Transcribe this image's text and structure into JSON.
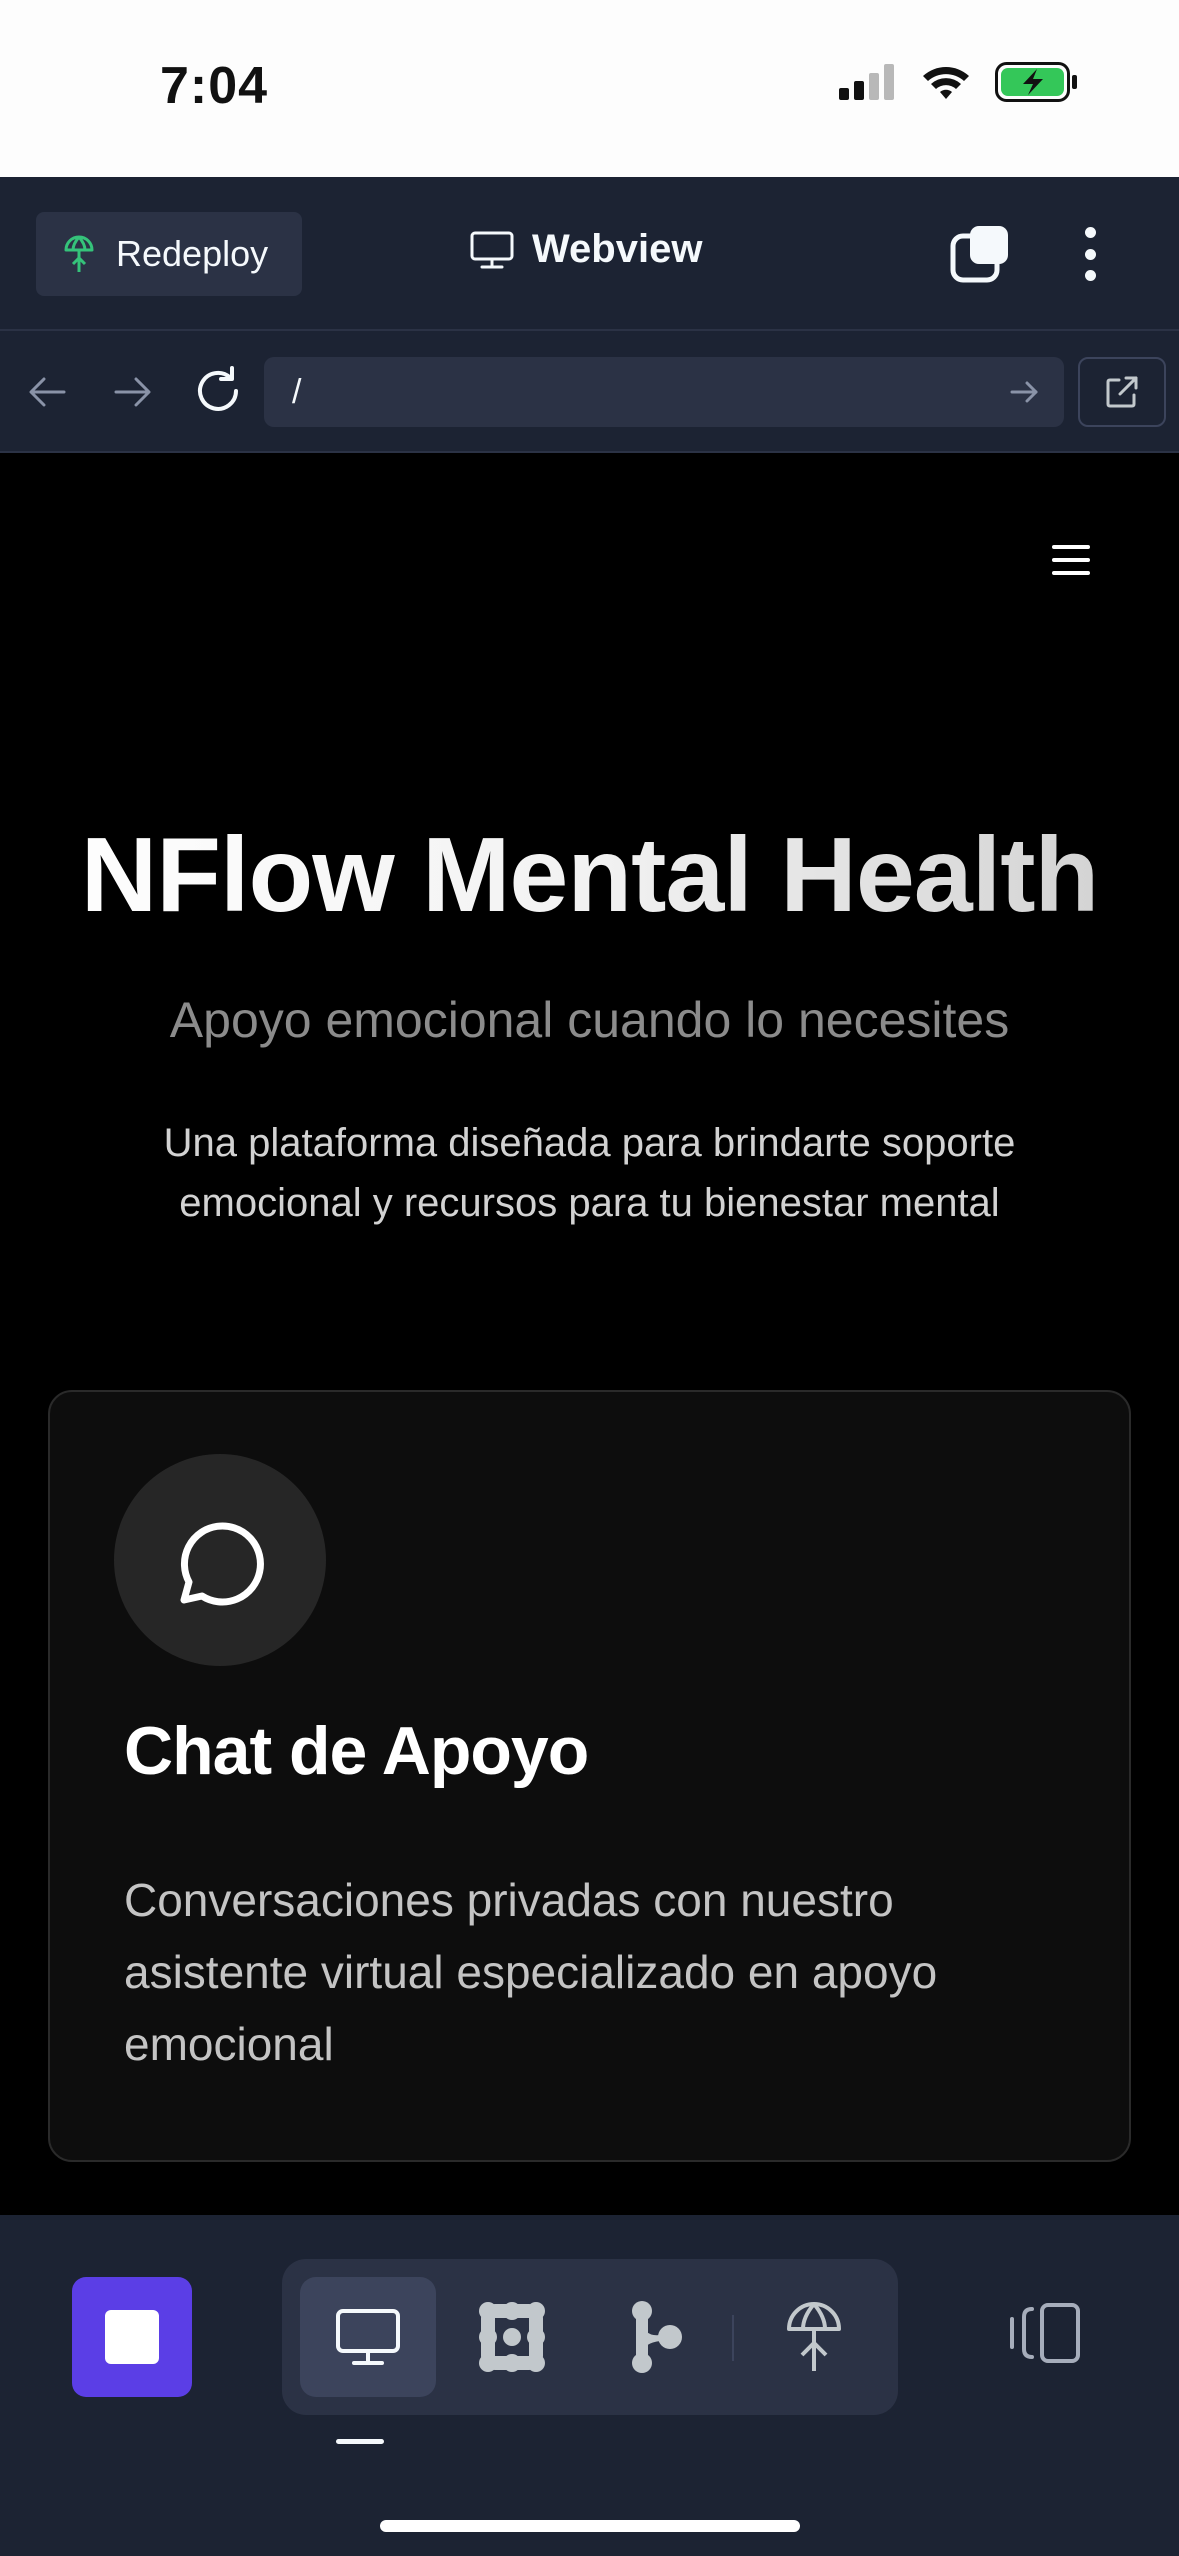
{
  "status_bar": {
    "time": "7:04",
    "icons": [
      "cellular-signal-icon",
      "wifi-icon",
      "battery-charging-icon"
    ]
  },
  "top_bar": {
    "redeploy_label": "Redeploy",
    "webview_label": "Webview",
    "icons": [
      "deploy-icon",
      "monitor-icon",
      "tabs-icon",
      "more-options-icon"
    ]
  },
  "url_bar": {
    "url": "/"
  },
  "page": {
    "title": "NFlow Mental Health",
    "subtitle": "Apoyo emocional cuando lo necesites",
    "description": "Una plataforma diseñada para brindarte soporte emocional y recursos para tu bienestar mental",
    "feature_card": {
      "icon": "chat-bubble-icon",
      "title": "Chat de Apoyo",
      "description": "Conversaciones privadas con nuestro asistente virtual especializado en apoyo emocional"
    }
  },
  "bottom_toolbar": {
    "tools": [
      "webview-tool",
      "packager-tool",
      "git-tool",
      "deployments-tool"
    ],
    "active_tool": "webview-tool"
  },
  "colors": {
    "replit_bg": "#1c2333",
    "replit_surface": "#2b3245",
    "accent_purple": "#5b3ee6",
    "battery_green": "#34c759",
    "deploy_green": "#35c37a"
  }
}
